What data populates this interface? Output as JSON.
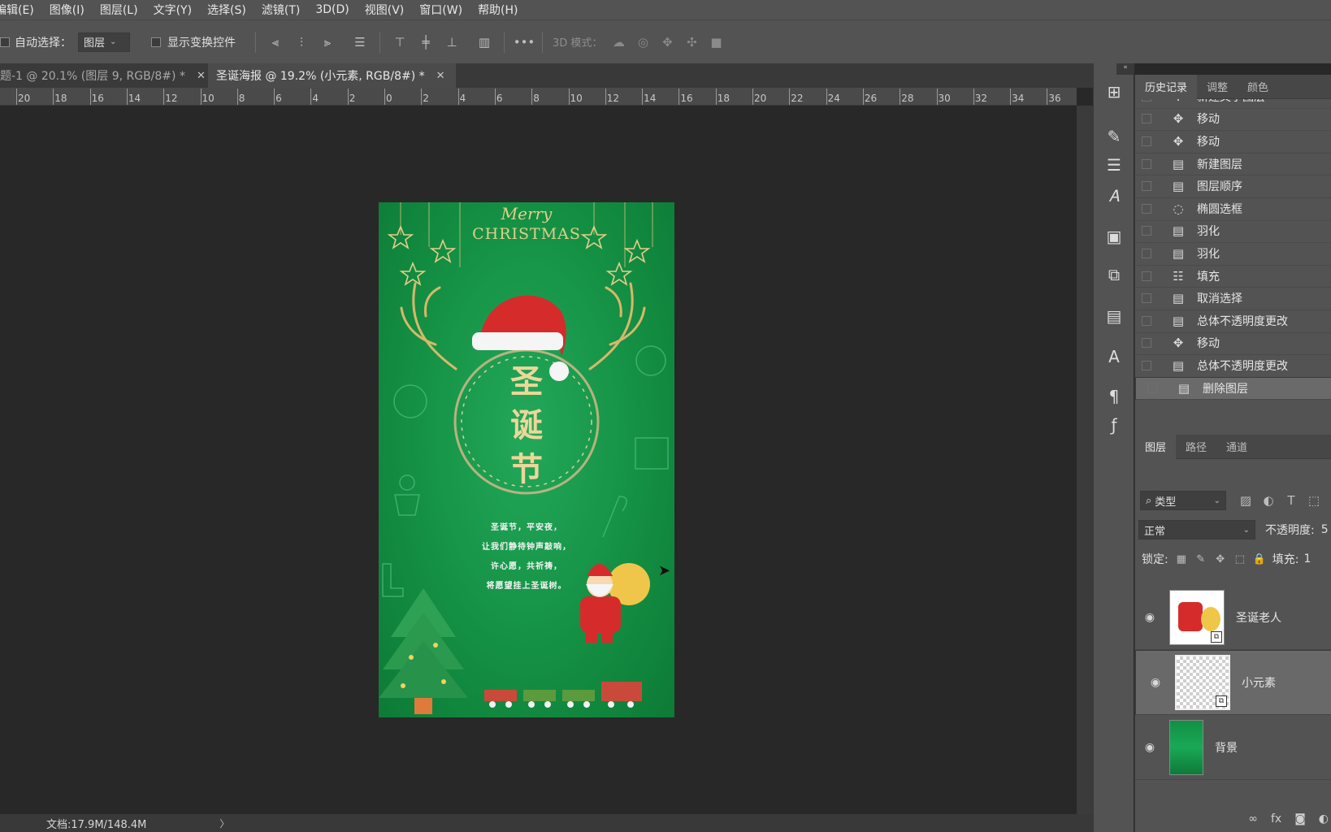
{
  "menu": [
    "编辑(E)",
    "图像(I)",
    "图层(L)",
    "文字(Y)",
    "选择(S)",
    "滤镜(T)",
    "3D(D)",
    "视图(V)",
    "窗口(W)",
    "帮助(H)"
  ],
  "options": {
    "auto_select_label": "自动选择：",
    "auto_select_value": "图层",
    "show_transform_label": "显示变换控件",
    "more": "•••",
    "mode_3d_label": "3D 模式："
  },
  "tabs": [
    {
      "label": "题-1 @ 20.1% (图层 9, RGB/8#) *",
      "close": "✕"
    },
    {
      "label": "圣诞海报 @ 19.2% (小元素, RGB/8#) *",
      "close": "✕"
    }
  ],
  "ruler": [
    "20",
    "18",
    "16",
    "14",
    "12",
    "10",
    "8",
    "6",
    "4",
    "2",
    "0",
    "2",
    "4",
    "6",
    "8",
    "10",
    "12",
    "14",
    "16",
    "18",
    "20",
    "22",
    "24",
    "26",
    "28",
    "30",
    "32",
    "34",
    "36"
  ],
  "status": {
    "doc": "文档:17.9M/148.4M",
    "arrow": "〉"
  },
  "poster": {
    "merry": "Merry",
    "christmas": "CHRISTMAS",
    "title_chars": [
      "圣",
      "诞",
      "节"
    ],
    "poem": [
      "圣诞节，平安夜，",
      "让我们静待钟声敲响，",
      "许心愿，共祈祷，",
      "将愿望挂上圣诞树。"
    ]
  },
  "history": {
    "tabs": [
      "历史记录",
      "调整",
      "颜色"
    ],
    "items": [
      {
        "icon": "text-tool-icon",
        "label": "新建文字图层"
      },
      {
        "icon": "move-icon",
        "label": "移动"
      },
      {
        "icon": "move-icon",
        "label": "移动"
      },
      {
        "icon": "document-icon",
        "label": "新建图层"
      },
      {
        "icon": "document-icon",
        "label": "图层顺序"
      },
      {
        "icon": "ellipse-marquee-icon",
        "label": "椭圆选框"
      },
      {
        "icon": "document-icon",
        "label": "羽化"
      },
      {
        "icon": "document-icon",
        "label": "羽化"
      },
      {
        "icon": "fill-icon",
        "label": "填充"
      },
      {
        "icon": "document-icon",
        "label": "取消选择"
      },
      {
        "icon": "document-icon",
        "label": "总体不透明度更改"
      },
      {
        "icon": "move-icon",
        "label": "移动"
      },
      {
        "icon": "document-icon",
        "label": "总体不透明度更改"
      },
      {
        "icon": "document-icon",
        "label": "删除图层"
      }
    ]
  },
  "layers": {
    "tabs": [
      "图层",
      "路径",
      "通道"
    ],
    "filter_label": "类型",
    "blend_mode": "正常",
    "opacity_label": "不透明度:",
    "opacity_value": "5",
    "lock_label": "锁定:",
    "fill_label": "填充:",
    "fill_value": "1",
    "items": [
      {
        "name": "圣诞老人",
        "visible": true,
        "selected": false
      },
      {
        "name": "小元素",
        "visible": true,
        "selected": true
      },
      {
        "name": "背景",
        "visible": true,
        "selected": false
      }
    ]
  },
  "colors": {
    "poster_green": "#149044",
    "gold": "#d8b86a",
    "panel": "#535353",
    "canvas": "#282828"
  }
}
